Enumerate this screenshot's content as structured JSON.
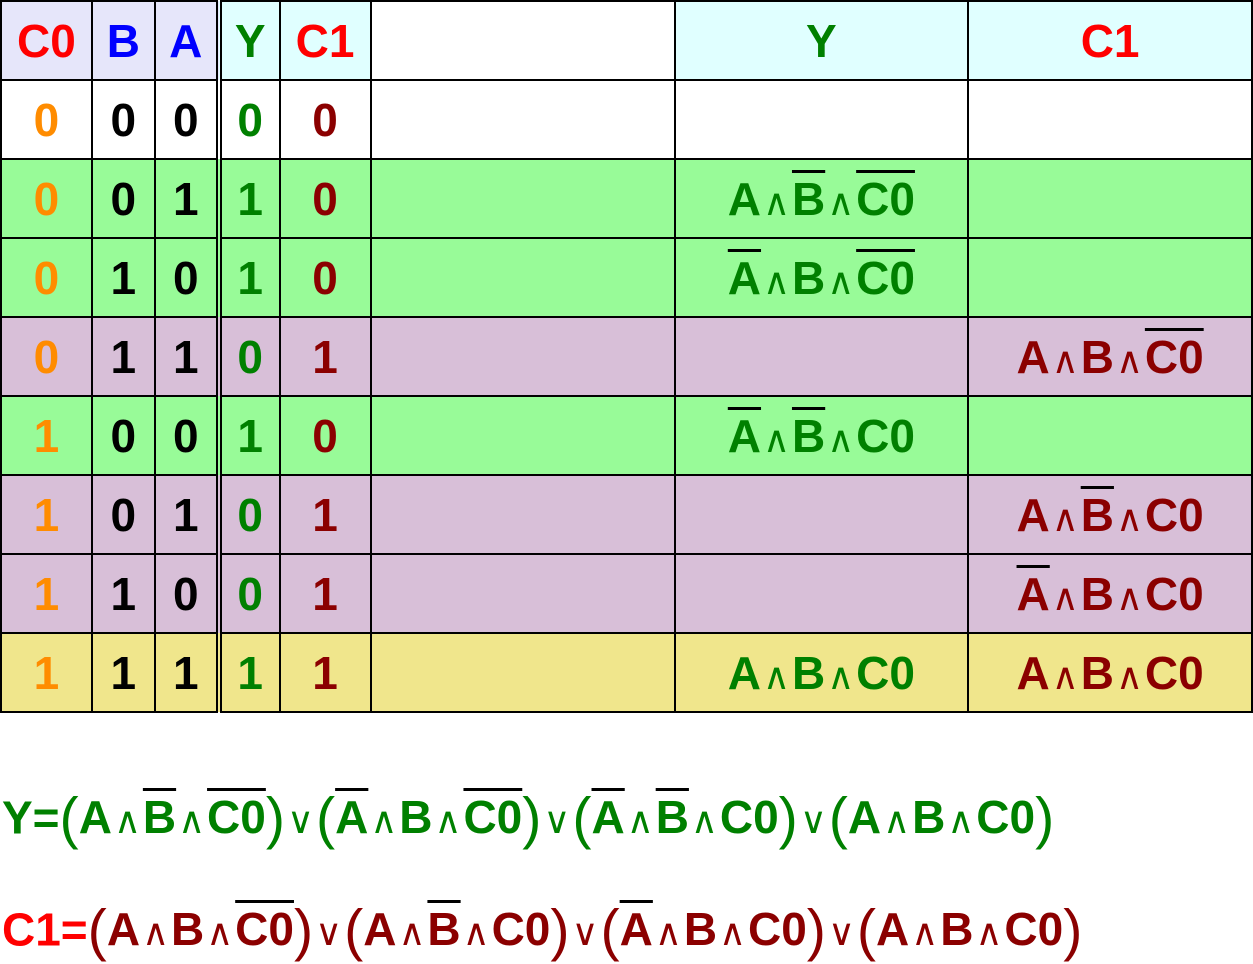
{
  "colors": {
    "c0_header": "#ff0000",
    "b_header": "#0000ff",
    "a_header": "#0000ff",
    "y": "#008000",
    "c1_header": "#ff0000",
    "c0_value": "#ff8c00",
    "ab_value": "#000000",
    "c1_value": "#8b0000"
  },
  "table": {
    "headers": [
      "C0",
      "B",
      "A",
      "Y",
      "C1",
      "",
      "Y",
      "C1"
    ],
    "rows": [
      {
        "c0": "0",
        "b": "0",
        "a": "0",
        "y": "0",
        "c1": "0",
        "bg": "white",
        "y_term": null,
        "c1_term": null
      },
      {
        "c0": "0",
        "b": "0",
        "a": "1",
        "y": "1",
        "c1": "0",
        "bg": "green",
        "y_term": [
          {
            "v": "A",
            "neg": false
          },
          {
            "v": "B",
            "neg": true
          },
          {
            "v": "C0",
            "neg": true
          }
        ],
        "c1_term": null
      },
      {
        "c0": "0",
        "b": "1",
        "a": "0",
        "y": "1",
        "c1": "0",
        "bg": "green",
        "y_term": [
          {
            "v": "A",
            "neg": true
          },
          {
            "v": "B",
            "neg": false
          },
          {
            "v": "C0",
            "neg": true
          }
        ],
        "c1_term": null
      },
      {
        "c0": "0",
        "b": "1",
        "a": "1",
        "y": "0",
        "c1": "1",
        "bg": "purple",
        "y_term": null,
        "c1_term": [
          {
            "v": "A",
            "neg": false
          },
          {
            "v": "B",
            "neg": false
          },
          {
            "v": "C0",
            "neg": true
          }
        ]
      },
      {
        "c0": "1",
        "b": "0",
        "a": "0",
        "y": "1",
        "c1": "0",
        "bg": "green",
        "y_term": [
          {
            "v": "A",
            "neg": true
          },
          {
            "v": "B",
            "neg": true
          },
          {
            "v": "C0",
            "neg": false
          }
        ],
        "c1_term": null
      },
      {
        "c0": "1",
        "b": "0",
        "a": "1",
        "y": "0",
        "c1": "1",
        "bg": "purple",
        "y_term": null,
        "c1_term": [
          {
            "v": "A",
            "neg": false
          },
          {
            "v": "B",
            "neg": true
          },
          {
            "v": "C0",
            "neg": false
          }
        ]
      },
      {
        "c0": "1",
        "b": "1",
        "a": "0",
        "y": "0",
        "c1": "1",
        "bg": "purple",
        "y_term": null,
        "c1_term": [
          {
            "v": "A",
            "neg": true
          },
          {
            "v": "B",
            "neg": false
          },
          {
            "v": "C0",
            "neg": false
          }
        ]
      },
      {
        "c0": "1",
        "b": "1",
        "a": "1",
        "y": "1",
        "c1": "1",
        "bg": "yellow",
        "y_term": [
          {
            "v": "A",
            "neg": false
          },
          {
            "v": "B",
            "neg": false
          },
          {
            "v": "C0",
            "neg": false
          }
        ],
        "c1_term": [
          {
            "v": "A",
            "neg": false
          },
          {
            "v": "B",
            "neg": false
          },
          {
            "v": "C0",
            "neg": false
          }
        ]
      }
    ]
  },
  "symbols": {
    "and": "∧",
    "or": "∨",
    "open": "(",
    "close": ")"
  },
  "equations": {
    "y": {
      "lhs": "Y=",
      "terms": [
        [
          {
            "v": "A",
            "neg": false
          },
          {
            "v": "B",
            "neg": true
          },
          {
            "v": "C0",
            "neg": true
          }
        ],
        [
          {
            "v": "A",
            "neg": true
          },
          {
            "v": "B",
            "neg": false
          },
          {
            "v": "C0",
            "neg": true
          }
        ],
        [
          {
            "v": "A",
            "neg": true
          },
          {
            "v": "B",
            "neg": true
          },
          {
            "v": "C0",
            "neg": false
          }
        ],
        [
          {
            "v": "A",
            "neg": false
          },
          {
            "v": "B",
            "neg": false
          },
          {
            "v": "C0",
            "neg": false
          }
        ]
      ]
    },
    "c1": {
      "lhs": "C1=",
      "terms": [
        [
          {
            "v": "A",
            "neg": false
          },
          {
            "v": "B",
            "neg": false
          },
          {
            "v": "C0",
            "neg": true
          }
        ],
        [
          {
            "v": "A",
            "neg": false
          },
          {
            "v": "B",
            "neg": true
          },
          {
            "v": "C0",
            "neg": false
          }
        ],
        [
          {
            "v": "A",
            "neg": true
          },
          {
            "v": "B",
            "neg": false
          },
          {
            "v": "C0",
            "neg": false
          }
        ],
        [
          {
            "v": "A",
            "neg": false
          },
          {
            "v": "B",
            "neg": false
          },
          {
            "v": "C0",
            "neg": false
          }
        ]
      ]
    }
  }
}
